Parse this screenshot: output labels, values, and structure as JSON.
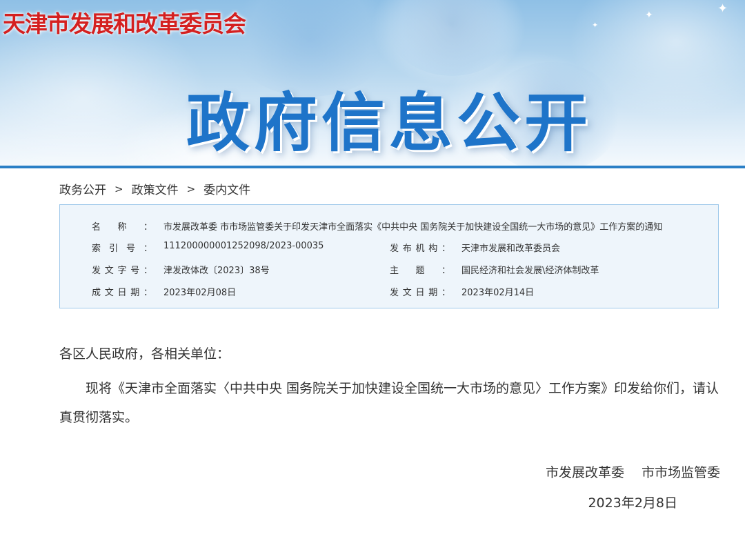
{
  "header": {
    "site_title": "天津市发展和改革委员会",
    "banner_title": "政府信息公开"
  },
  "breadcrumb": [
    "政务公开",
    "政策文件",
    "委内文件"
  ],
  "breadcrumb_sep": ">",
  "info": {
    "name_label": [
      "名",
      "称"
    ],
    "name_value": "市发展改革委 市市场监管委关于印发天津市全面落实《中共中央 国务院关于加快建设全国统一大市场的意见》工作方案的通知",
    "index_label": [
      "索",
      "引",
      "号"
    ],
    "index_value": "111200000001252098/2023-00035",
    "publisher_label": [
      "发",
      "布",
      "机",
      "构"
    ],
    "publisher_value": "天津市发展和改革委员会",
    "doc_no_label": [
      "发",
      "文",
      "字",
      "号"
    ],
    "doc_no_value": "津发改体改〔2023〕38号",
    "subject_label": [
      "主",
      "题"
    ],
    "subject_value": "国民经济和社会发展\\经济体制改革",
    "created_label": [
      "成",
      "文",
      "日",
      "期"
    ],
    "created_value": "2023年02月08日",
    "issued_label": [
      "发",
      "文",
      "日",
      "期"
    ],
    "issued_value": "2023年02月14日",
    "colon": "："
  },
  "body": {
    "salutation": "各区人民政府，各相关单位：",
    "paragraph": "现将《天津市全面落实〈中共中央 国务院关于加快建设全国统一大市场的意见〉工作方案》印发给你们，请认真贯彻落实。",
    "signature": "市发展改革委　 市市场监管委",
    "date": "2023年2月8日"
  },
  "colors": {
    "site_title": "#d42020",
    "banner_title": "#1e74c9",
    "info_bg": "#eef5fb",
    "info_border": "#9ec8ea"
  }
}
